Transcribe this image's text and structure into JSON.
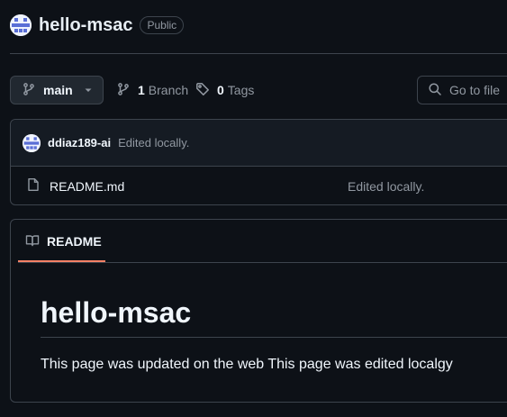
{
  "repo": {
    "name": "hello-msac",
    "visibility": "Public"
  },
  "toolbar": {
    "branch_label": "main",
    "branch_count": "1",
    "branch_text": "Branch",
    "tag_count": "0",
    "tag_text": "Tags",
    "goto_file_placeholder": "Go to file"
  },
  "latest_commit": {
    "author": "ddiaz189-ai",
    "message": "Edited locally."
  },
  "files": [
    {
      "name": "README.md",
      "commit_message": "Edited locally."
    }
  ],
  "readme": {
    "tab_label": "README",
    "heading": "hello-msac",
    "paragraph": "This page was updated on the web This page was edited localgy"
  },
  "icons": {
    "avatar": "identicon-avatar",
    "branch": "git-branch-icon",
    "caret": "triangle-down-icon",
    "tag": "tag-icon",
    "search": "search-icon",
    "file": "file-icon",
    "book": "book-icon"
  },
  "colors": {
    "background": "#0d1117",
    "border": "#3d444d",
    "muted_text": "#9198a1",
    "text": "#f0f6fc",
    "tab_underline": "#f78166"
  }
}
